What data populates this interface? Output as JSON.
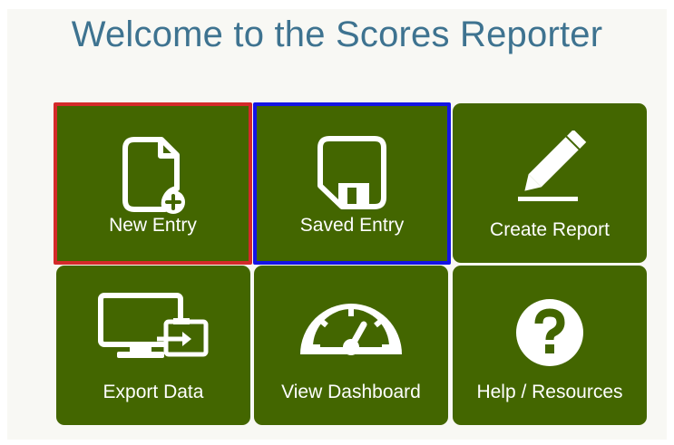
{
  "page": {
    "title": "Welcome to the Scores Reporter",
    "background_color": "#f8f8f4",
    "title_color": "#3e7390",
    "tile_color": "#436600"
  },
  "tiles": [
    {
      "label": "New Entry",
      "icon": "new-file-icon",
      "highlight": "#d42a2a"
    },
    {
      "label": "Saved Entry",
      "icon": "floppy-disk-icon",
      "highlight": "#1414e6"
    },
    {
      "label": "Create Report",
      "icon": "pencil-icon"
    },
    {
      "label": "Export Data",
      "icon": "monitor-export-icon"
    },
    {
      "label": "View Dashboard",
      "icon": "gauge-icon"
    },
    {
      "label": "Help / Resources",
      "icon": "question-icon"
    }
  ]
}
